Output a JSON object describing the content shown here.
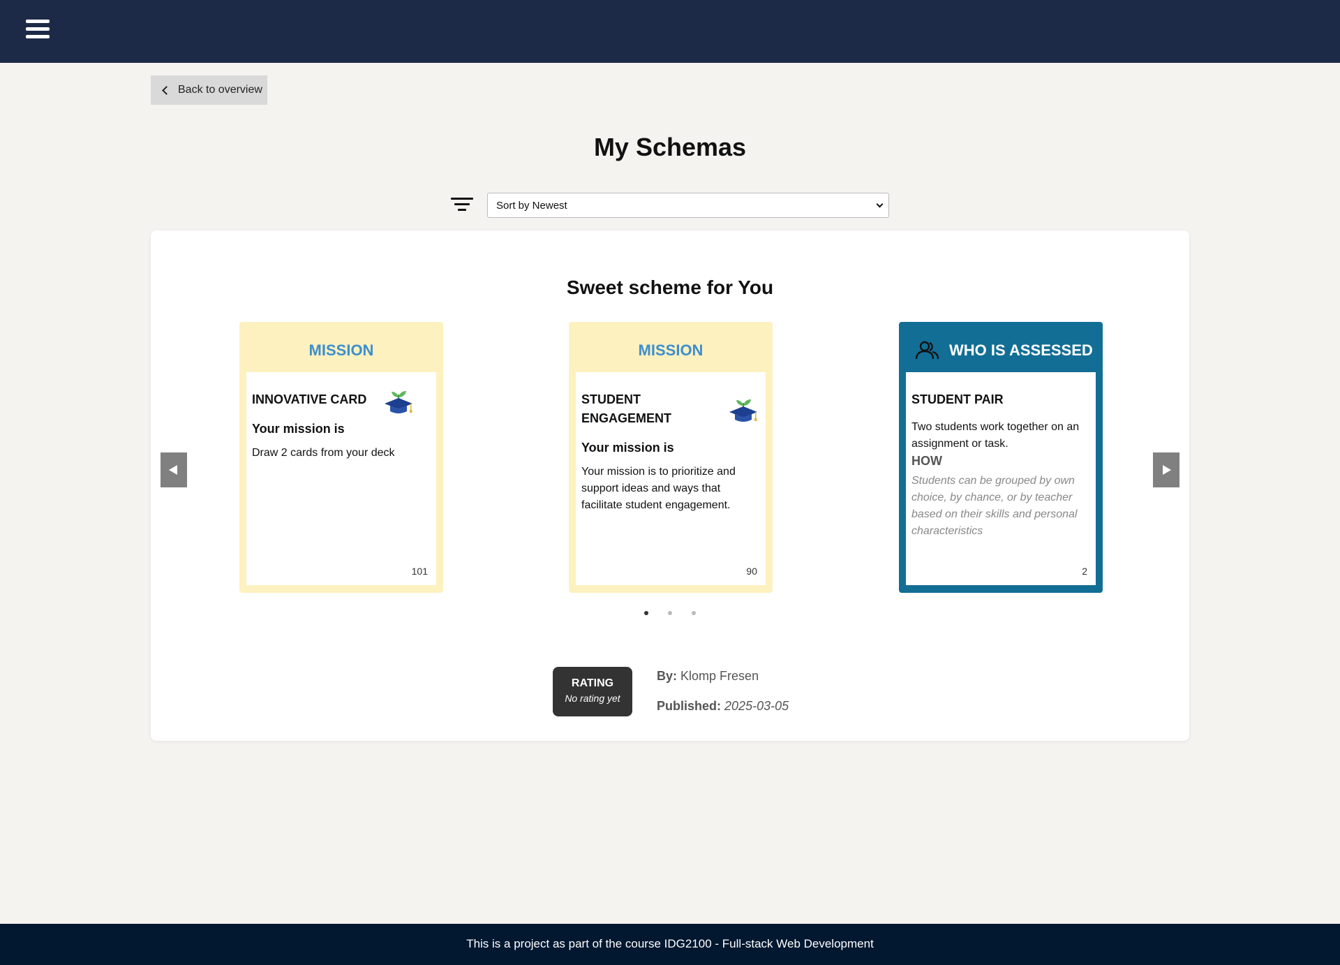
{
  "header": {
    "menu_icon": "hamburger-menu-icon"
  },
  "nav": {
    "back_label": "Back to overview"
  },
  "page": {
    "title": "My Schemas"
  },
  "sort": {
    "selected": "Sort by Newest",
    "filter_icon": "filter-icon"
  },
  "scheme": {
    "title": "Sweet scheme for You",
    "cards": [
      {
        "category": "MISSION",
        "name": "INNOVATIVE CARD",
        "mission_label": "Your mission is",
        "text": "Draw 2 cards from your deck",
        "number": "101",
        "icon": "graduation-cap-sprout-icon"
      },
      {
        "category": "MISSION",
        "name": "STUDENT ENGAGEMENT",
        "mission_label": "Your mission is",
        "text": "Your mission is to prioritize and support ideas and ways that facilitate student engagement.",
        "number": "90",
        "icon": "graduation-cap-sprout-icon"
      },
      {
        "category": "WHO IS ASSESSED",
        "name": "STUDENT PAIR",
        "text": "Two students work together on an assignment or task.",
        "how_label": "HOW",
        "how_text": "Students can be grouped by own choice, by chance, or by teacher based on their skills and personal characteristics",
        "number": "2",
        "icon": "people-icon"
      }
    ],
    "pagination": {
      "total": 3,
      "active": 1
    },
    "rating": {
      "title": "RATING",
      "value": "No rating yet"
    },
    "author": {
      "label": "By:",
      "name": "Klomp Fresen"
    },
    "published": {
      "label": "Published:",
      "date": "2025-03-05"
    }
  },
  "colors": {
    "topbar": "#1d2a47",
    "footer": "#021730",
    "mission_card": "#fdf1c0",
    "mission_title": "#3d8fcd",
    "assess_card": "#136e95"
  },
  "footer": {
    "text": "This is a project as part of the course IDG2100 - Full-stack Web Development"
  }
}
